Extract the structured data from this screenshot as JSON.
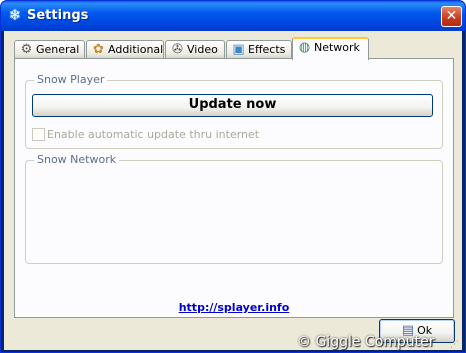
{
  "window": {
    "title": "Settings",
    "app_icon": "snowflake-icon",
    "close_label": "✕"
  },
  "tabs": [
    {
      "label": "General",
      "icon": "gear-icon",
      "active": false
    },
    {
      "label": "Additional",
      "icon": "paint-icon",
      "active": false
    },
    {
      "label": "Video",
      "icon": "film-reel-icon",
      "active": false
    },
    {
      "label": "Effects",
      "icon": "effects-icon",
      "active": false
    },
    {
      "label": "Network",
      "icon": "globe-icon",
      "active": true
    }
  ],
  "snow_player": {
    "group_title": "Snow Player",
    "update_button": "Update now",
    "auto_update_label": "Enable automatic update thru internet",
    "auto_update_checked": false
  },
  "snow_network": {
    "group_title": "Snow Network"
  },
  "link": "http://splayer.info",
  "ok_button": "Ok",
  "watermark": "© Giggle Computer",
  "colors": {
    "titlebar": "#0058ee",
    "client": "#ece9d8",
    "panel": "#fcfcfe",
    "active_tab_accent": "#ffc83c",
    "link": "#0000cc",
    "group_label": "#5b6e8c"
  }
}
